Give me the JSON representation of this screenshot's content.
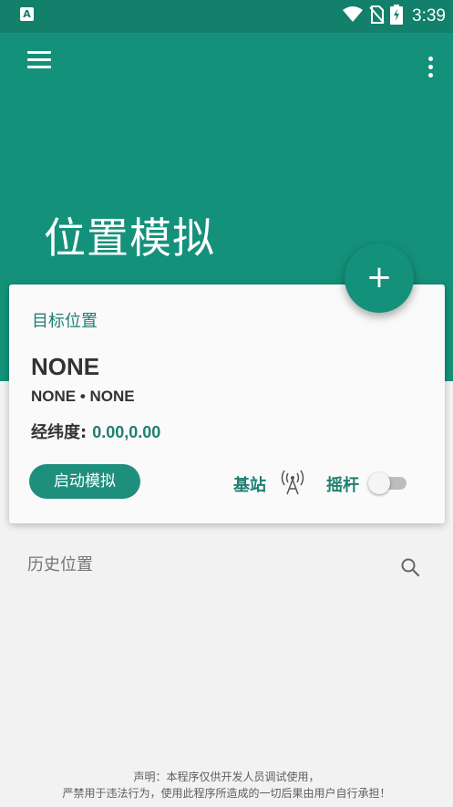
{
  "status_bar": {
    "app_icon_letter": "A",
    "time": "3:39",
    "icons": [
      "wifi-icon",
      "no-sim-icon",
      "battery-charging-icon"
    ]
  },
  "app_bar": {
    "menu_icon": "hamburger-menu-icon",
    "more_icon": "more-vert-icon"
  },
  "header": {
    "title": "位置模拟",
    "fab_label": "+",
    "color": "#14917a"
  },
  "target_card": {
    "label": "目标位置",
    "location_name": "NONE",
    "location_sub": "NONE • NONE",
    "coords_label": "经纬度:",
    "coords_value": "0.00,0.00",
    "start_button": "启动模拟",
    "base_station_label": "基站",
    "base_station_icon": "antenna-icon",
    "joystick_label": "摇杆",
    "joystick_enabled": false,
    "accent": "#1f7f72"
  },
  "history": {
    "title": "历史位置",
    "search_icon": "search-icon"
  },
  "disclaimer": {
    "line1": "声明：本程序仅供开发人员调试使用，",
    "line2": "严禁用于违法行为，使用此程序所造成的一切后果由用户自行承担！"
  }
}
